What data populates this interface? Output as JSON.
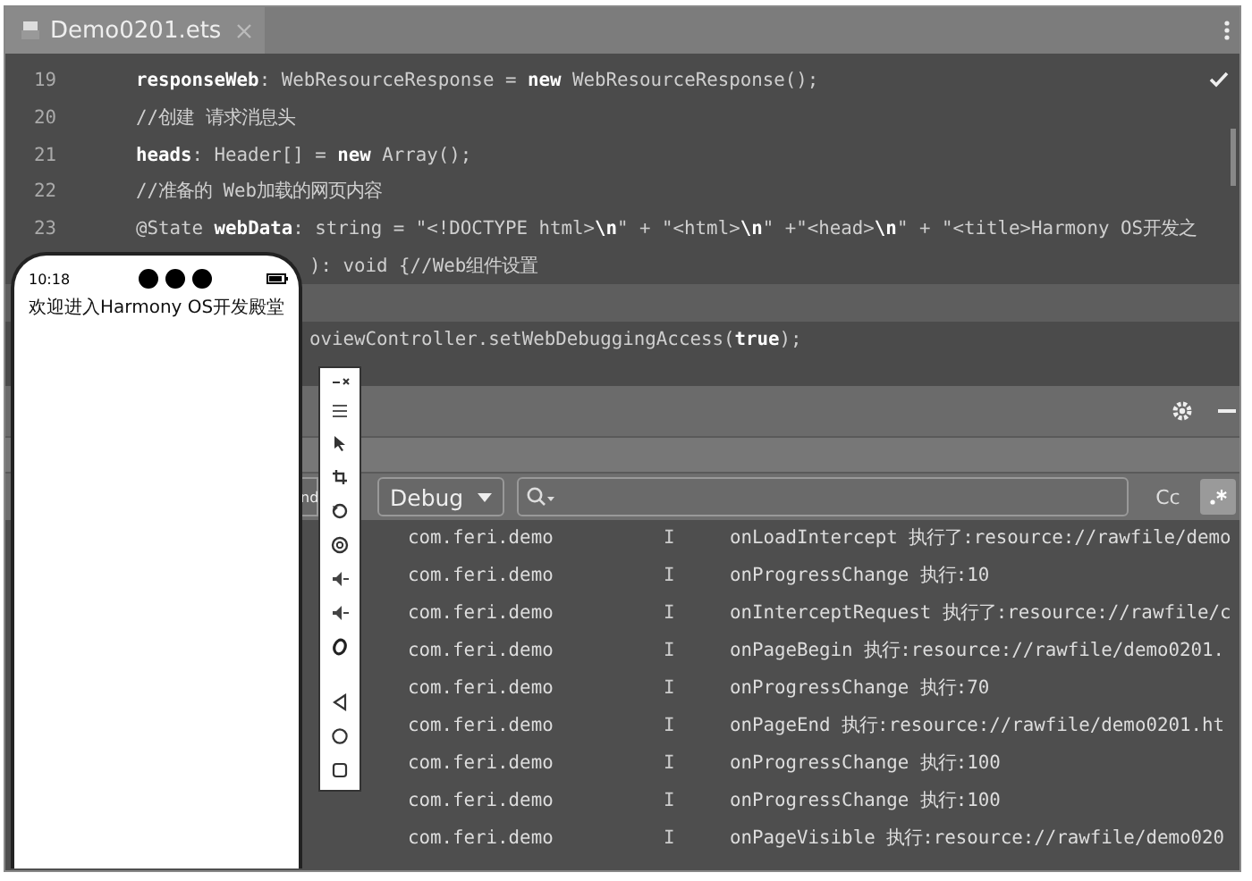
{
  "editor": {
    "tab": {
      "label": "Demo0201.ets",
      "selected": true
    },
    "lines": [
      {
        "number": "19",
        "code": "**responseWeb**: WebResourceResponse = **new** WebResourceResponse();",
        "current": false
      },
      {
        "number": "20",
        "code": "//创建 请求消息头",
        "current": false
      },
      {
        "number": "21",
        "code": "**heads**: Header[] = **new** Array();",
        "current": false
      },
      {
        "number": "22",
        "code": "//准备的 Web加载的网页内容",
        "current": false
      },
      {
        "number": "23",
        "code": "@State **webData**: string = \"<!DOCTYPE html>**\\n**\" + \"<html>**\\n**\" +\"<head>**\\n**\" + \"<title>Harmony OS开发之",
        "current": false
      },
      {
        "code": "): void {//Web组件设置",
        "current": false
      },
      {
        "current": true
      },
      {
        "code": "oviewController.setWebDebuggingAccess(**true**);",
        "current": false
      }
    ]
  },
  "log": {
    "filters": {
      "device_dropdown": {
        "value": "nd"
      },
      "level_dropdown": {
        "value": "Debug"
      },
      "match_case": {
        "label": "Cc",
        "selected": false
      },
      "regex": {
        "selected": true
      }
    },
    "rows": [
      {
        "package": "com.feri.demo",
        "level": "I",
        "message": "onLoadIntercept 执行了:resource://rawfile/demo"
      },
      {
        "package": "com.feri.demo",
        "level": "I",
        "message": "onProgressChange 执行:10"
      },
      {
        "package": "com.feri.demo",
        "level": "I",
        "message": "onInterceptRequest 执行了:resource://rawfile/c"
      },
      {
        "package": "com.feri.demo",
        "level": "I",
        "message": "onPageBegin 执行:resource://rawfile/demo0201."
      },
      {
        "package": "com.feri.demo",
        "level": "I",
        "message": "onProgressChange 执行:70"
      },
      {
        "package": "com.feri.demo",
        "level": "I",
        "message": "onPageEnd 执行:resource://rawfile/demo0201.ht"
      },
      {
        "package": "com.feri.demo",
        "level": "I",
        "message": "onProgressChange 执行:100"
      },
      {
        "package": "com.feri.demo",
        "level": "I",
        "message": "onProgressChange 执行:100"
      },
      {
        "package": "com.feri.demo",
        "level": "I",
        "message": "onPageVisible 执行:resource://rawfile/demo020"
      }
    ]
  },
  "phone": {
    "time": "10:18",
    "page_text": "欢迎进入Harmony OS开发殿堂"
  }
}
